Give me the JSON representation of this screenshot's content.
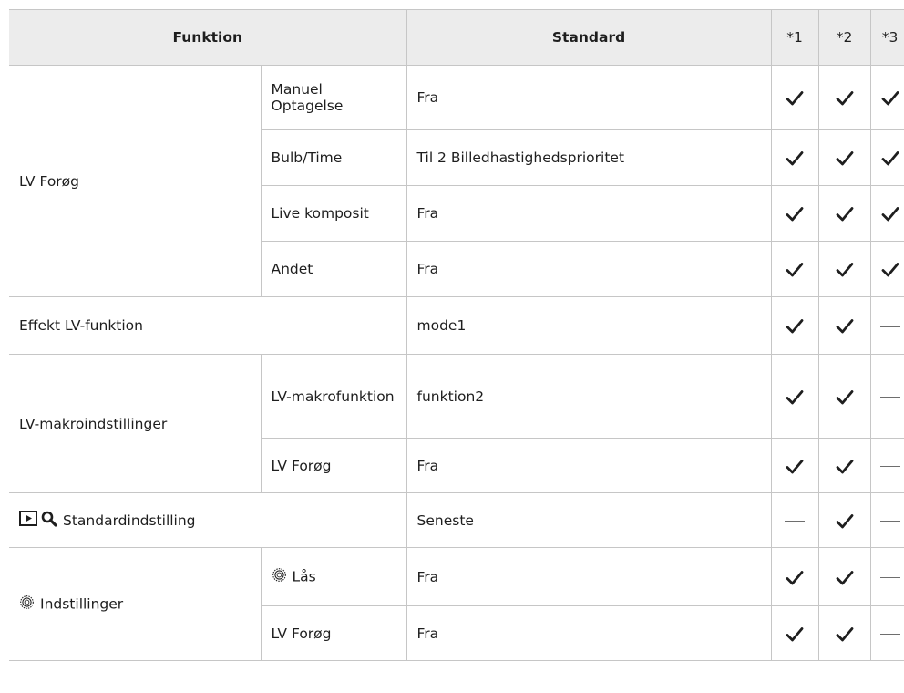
{
  "header": {
    "funktion": "Funktion",
    "standard": "Standard",
    "c1": "*1",
    "c2": "*2",
    "c3": "*3"
  },
  "groups": {
    "lv_forog": {
      "label": "LV Forøg",
      "rows": [
        {
          "sub": "Manuel Optagelse",
          "standard": "Fra",
          "marks": [
            "check",
            "check",
            "check"
          ]
        },
        {
          "sub": "Bulb/Time",
          "standard": "Til 2 Billedhastighedsprioritet",
          "marks": [
            "check",
            "check",
            "check"
          ]
        },
        {
          "sub": "Live komposit",
          "standard": "Fra",
          "marks": [
            "check",
            "check",
            "check"
          ]
        },
        {
          "sub": "Andet",
          "standard": "Fra",
          "marks": [
            "check",
            "check",
            "check"
          ]
        }
      ]
    },
    "effekt": {
      "label": "Effekt LV-funktion",
      "standard": "mode1",
      "marks": [
        "check",
        "check",
        "dash"
      ]
    },
    "lv_makro": {
      "label": "LV-makroindstillinger",
      "rows": [
        {
          "sub": "LV-makrofunktion",
          "standard": "funktion2",
          "marks": [
            "check",
            "check",
            "dash"
          ]
        },
        {
          "sub": "LV Forøg",
          "standard": "Fra",
          "marks": [
            "check",
            "check",
            "dash"
          ]
        }
      ]
    },
    "standardindst": {
      "label": "Standardindstilling",
      "icons": [
        "play-icon",
        "magnifier-icon"
      ],
      "standard": "Seneste",
      "marks": [
        "dash",
        "check",
        "dash"
      ]
    },
    "indstillinger": {
      "label": "Indstillinger",
      "icon": "dial-icon",
      "rows": [
        {
          "sub": "Lås",
          "icon": "dial-icon",
          "standard": "Fra",
          "marks": [
            "check",
            "check",
            "dash"
          ]
        },
        {
          "sub": "LV Forøg",
          "standard": "Fra",
          "marks": [
            "check",
            "check",
            "dash"
          ]
        }
      ]
    }
  }
}
